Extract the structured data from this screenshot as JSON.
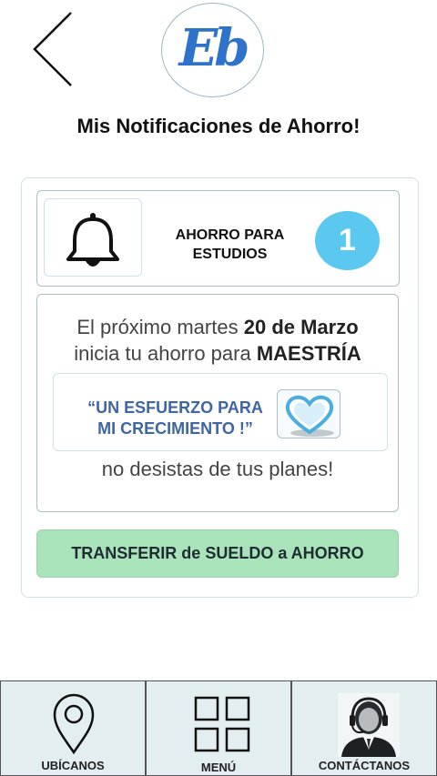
{
  "header": {
    "logo_text": "Eb",
    "title": "Mis Notificaciones de Ahorro!"
  },
  "notification": {
    "category_line1": "AHORRO PARA",
    "category_line2": "ESTUDIOS",
    "badge_count": "1",
    "message": {
      "line1_prefix": "El próximo martes",
      "line1_date": "20 de Marzo",
      "line2_prefix": "inicia tu ahorro  para",
      "line2_goal": "MAESTRÍA"
    },
    "quote_line1": "“UN ESFUERZO PARA",
    "quote_line2": "MI CRECIMIENTO !”",
    "closing": "no desistas de tus planes!",
    "action_label": "TRANSFERIR de SUELDO a  AHORRO"
  },
  "nav": {
    "items": [
      {
        "label": "UBÍCANOS",
        "icon": "location-pin-icon"
      },
      {
        "label": "MENÚ",
        "icon": "grid-menu-icon"
      },
      {
        "label": "CONTÁCTANOS",
        "icon": "support-agent-icon"
      }
    ]
  },
  "colors": {
    "badge": "#5bc8ef",
    "quote": "#3d66a3",
    "action_bg": "#a9e3b9",
    "nav_bg": "#e3eef0",
    "logo": "#2f72c9"
  }
}
